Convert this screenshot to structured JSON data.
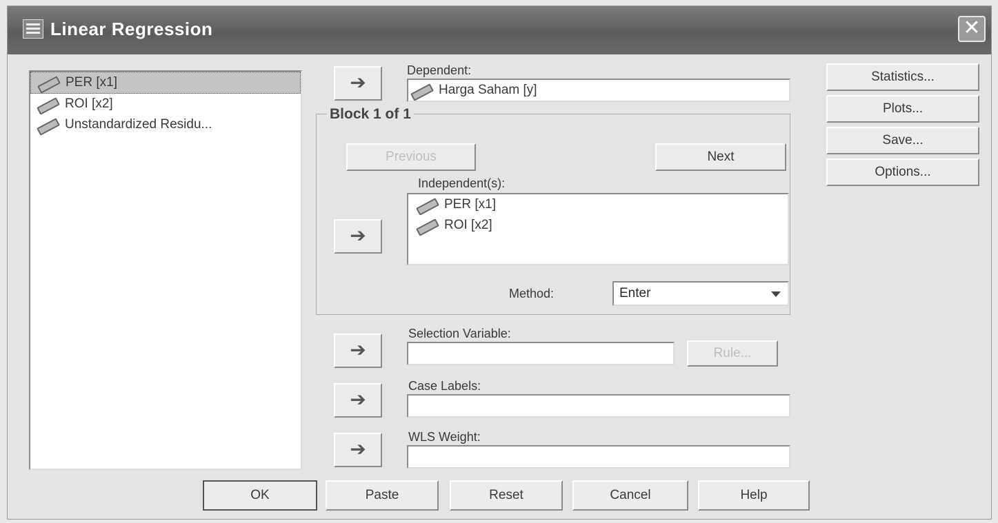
{
  "window": {
    "title": "Linear Regression",
    "close_glyph": "✕"
  },
  "variables": [
    "PER [x1]",
    "ROI [x2]",
    "Unstandardized Residu..."
  ],
  "dependent": {
    "label": "Dependent:",
    "value": "Harga Saham [y]"
  },
  "block": {
    "title": "Block 1 of 1",
    "previous_label": "Previous",
    "next_label": "Next"
  },
  "independents": {
    "label": "Independent(s):",
    "items": [
      "PER [x1]",
      "ROI [x2]"
    ]
  },
  "method": {
    "label": "Method:",
    "value": "Enter"
  },
  "selection_variable": {
    "label": "Selection Variable:",
    "value": "",
    "rule_label": "Rule..."
  },
  "case_labels": {
    "label": "Case Labels:",
    "value": ""
  },
  "wls_weight": {
    "label": "WLS Weight:",
    "value": ""
  },
  "side_buttons": [
    "Statistics...",
    "Plots...",
    "Save...",
    "Options..."
  ],
  "bottom_buttons": [
    "OK",
    "Paste",
    "Reset",
    "Cancel",
    "Help"
  ],
  "arrow_glyph": "➔"
}
